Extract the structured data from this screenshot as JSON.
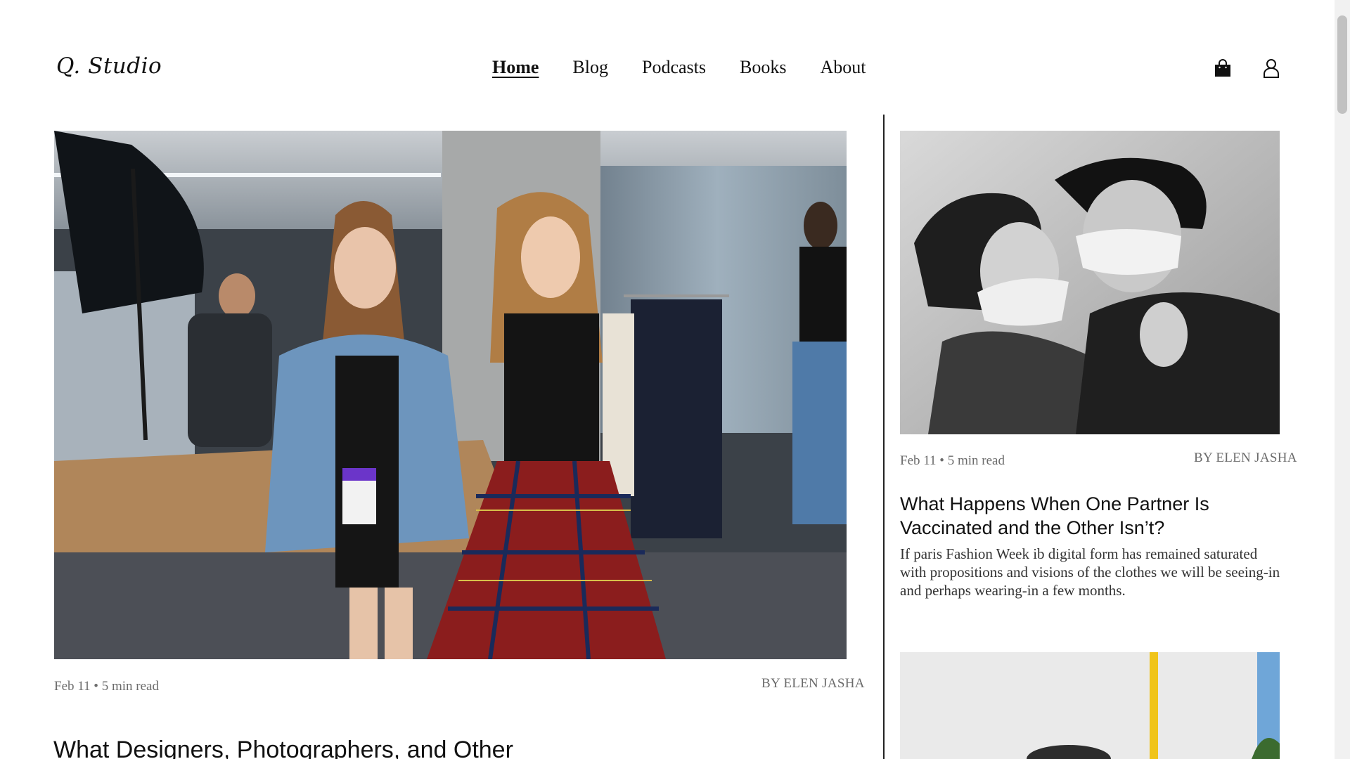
{
  "header": {
    "logo": "Q. Studio",
    "nav": [
      {
        "label": "Home",
        "active": true
      },
      {
        "label": "Blog",
        "active": false
      },
      {
        "label": "Podcasts",
        "active": false
      },
      {
        "label": "Books",
        "active": false
      },
      {
        "label": "About",
        "active": false
      }
    ],
    "icons": [
      "shopping-bag-icon",
      "user-icon"
    ]
  },
  "featured": {
    "meta": "Feb 11 • 5 min read",
    "byline": "BY ELEN JASHA",
    "title": "What Designers, Photographers, and Other"
  },
  "sidebar": {
    "post1": {
      "meta": "Feb 11 • 5 min read",
      "byline": "BY ELEN JASHA",
      "title": "What Happens When One Partner Is Vaccinated and the Other Isn’t?",
      "excerpt": "If paris Fashion Week ib digital form has remained saturated with propositions and visions of the clothes we will be seeing-in and perhaps wearing-in a few months."
    }
  },
  "colors": {
    "text": "#111111",
    "muted": "#6b6b6b",
    "divider": "#222222"
  }
}
